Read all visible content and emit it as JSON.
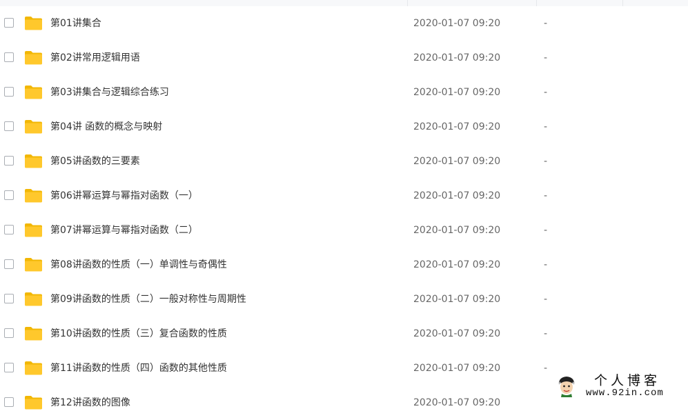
{
  "colors": {
    "folder": "#ffc82c",
    "folder_dark": "#f2b705",
    "name_text": "#333333",
    "meta_text": "#666666"
  },
  "icons": {
    "row_icon": "folder-icon",
    "row_check": "checkbox"
  },
  "files": [
    {
      "name": "第01讲集合",
      "modified": "2020-01-07 09:20",
      "size": "-"
    },
    {
      "name": "第02讲常用逻辑用语",
      "modified": "2020-01-07 09:20",
      "size": "-"
    },
    {
      "name": "第03讲集合与逻辑综合练习",
      "modified": "2020-01-07 09:20",
      "size": "-"
    },
    {
      "name": "第04讲 函数的概念与映射",
      "modified": "2020-01-07 09:20",
      "size": "-"
    },
    {
      "name": "第05讲函数的三要素",
      "modified": "2020-01-07 09:20",
      "size": "-"
    },
    {
      "name": "第06讲幂运算与幂指对函数（一）",
      "modified": "2020-01-07 09:20",
      "size": "-"
    },
    {
      "name": "第07讲幂运算与幂指对函数（二）",
      "modified": "2020-01-07 09:20",
      "size": "-"
    },
    {
      "name": "第08讲函数的性质（一）单调性与奇偶性",
      "modified": "2020-01-07 09:20",
      "size": "-"
    },
    {
      "name": "第09讲函数的性质（二）一般对称性与周期性",
      "modified": "2020-01-07 09:20",
      "size": "-"
    },
    {
      "name": "第10讲函数的性质（三）复合函数的性质",
      "modified": "2020-01-07 09:20",
      "size": "-"
    },
    {
      "name": "第11讲函数的性质（四）函数的其他性质",
      "modified": "2020-01-07 09:20",
      "size": "-"
    },
    {
      "name": "第12讲函数的图像",
      "modified": "2020-01-07 09:20",
      "size": ""
    }
  ],
  "watermark": {
    "title": "个人博客",
    "url": "www.92in.com",
    "avatar_icon": "cartoon-avatar-icon"
  }
}
